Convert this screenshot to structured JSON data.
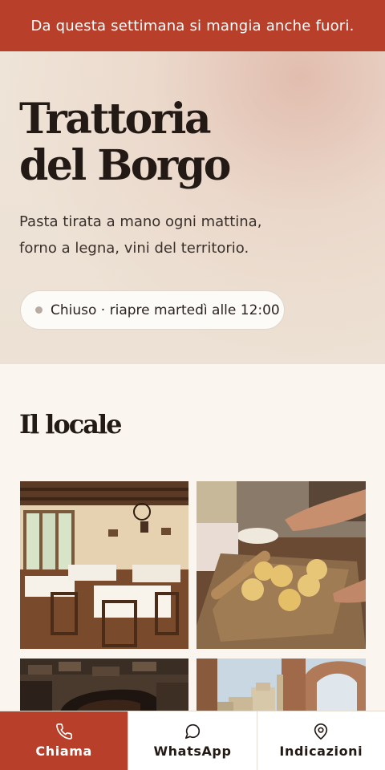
{
  "announcement": {
    "text": "Da questa settimana si mangia anche fuori."
  },
  "hero": {
    "title_line1": "Trattoria",
    "title_line2": "del Borgo",
    "desc_line1": "Pasta tirata a mano ogni mattina,",
    "desc_line2": "forno a legna, vini del territorio.",
    "status": "Chiuso · riapre martedì alle 12:00"
  },
  "gallery": {
    "title": "Il locale",
    "photos": [
      "dining-room-photo",
      "fresh-pasta-photo",
      "wood-oven-photo",
      "village-view-photo"
    ]
  },
  "actions": {
    "call": {
      "label": "Chiama",
      "icon": "phone-icon"
    },
    "whatsapp": {
      "label": "WhatsApp",
      "icon": "chat-bubble-icon"
    },
    "directions": {
      "label": "Indicazioni",
      "icon": "map-pin-icon"
    }
  },
  "colors": {
    "accent": "#b8402a",
    "background": "#faf5ef",
    "text": "#231a16"
  }
}
